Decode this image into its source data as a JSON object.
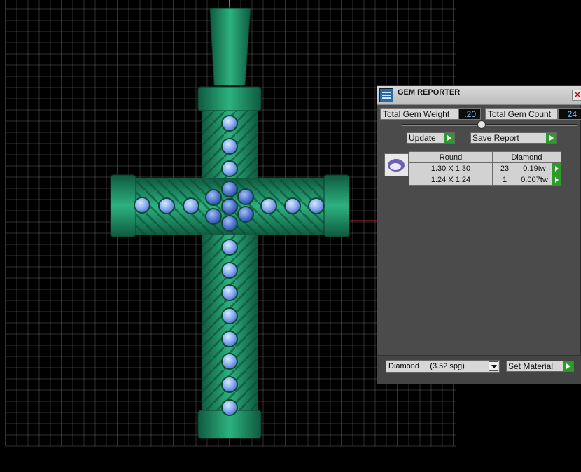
{
  "panel": {
    "title": "GEM REPORTER",
    "close_icon": "close-icon",
    "total_gem_weight_label": "Total Gem Weight",
    "total_gem_weight_value": ".20",
    "total_gem_count_label": "Total Gem Count",
    "total_gem_count_value": "24",
    "update_label": "Update",
    "save_report_label": "Save Report",
    "table": {
      "shape": "Round",
      "material": "Diamond",
      "rows": [
        {
          "size": "1.30 X 1.30",
          "count": "23",
          "weight": "0.19tw"
        },
        {
          "size": "1.24 X 1.24",
          "count": "1",
          "weight": "0.007tw"
        }
      ]
    },
    "material_select_value": "Diamond     (3.52 spg)",
    "set_material_label": "Set Material"
  },
  "colors": {
    "metal": "#1d8a63",
    "gem": "#8ab0f2",
    "grid": "#6e6e6e",
    "panel": "#4b4b4b"
  }
}
